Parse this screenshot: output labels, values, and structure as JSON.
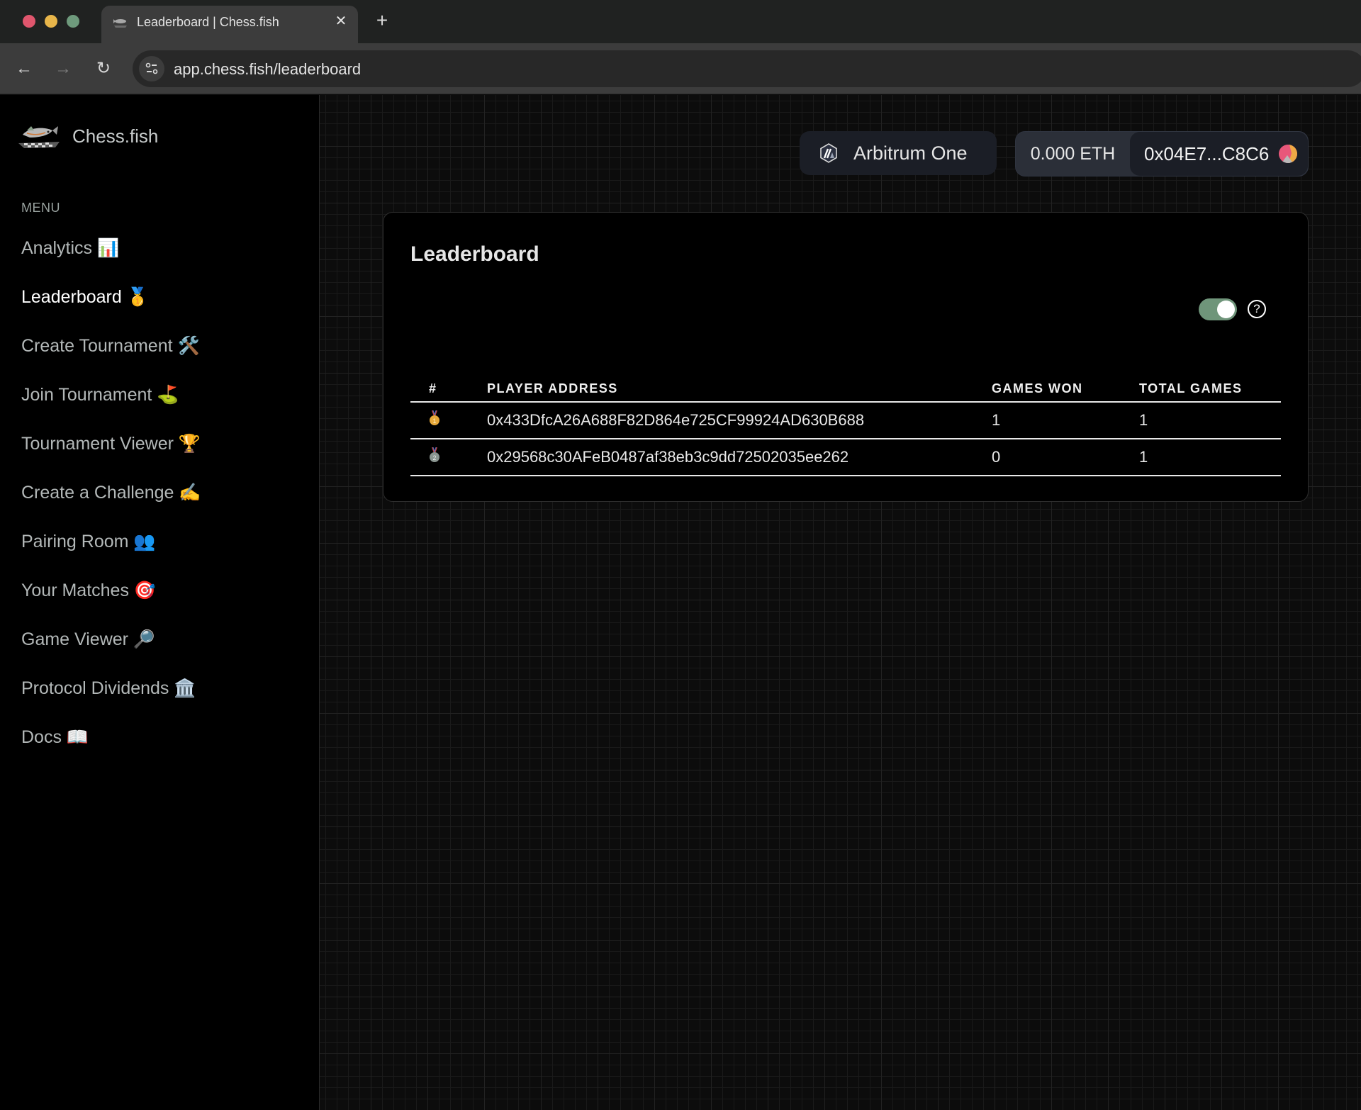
{
  "browser": {
    "tab_title": "Leaderboard | Chess.fish",
    "url": "app.chess.fish/leaderboard",
    "icons": {
      "back": "arrow-left-icon",
      "forward": "arrow-right-icon",
      "reload": "reload-icon",
      "site_info": "tune-icon",
      "close_tab": "close-icon",
      "new_tab": "plus-icon"
    }
  },
  "sidebar": {
    "brand": "Chess.fish",
    "menu_label": "MENU",
    "items": [
      {
        "label": "Analytics 📊",
        "active": false
      },
      {
        "label": "Leaderboard 🥇",
        "active": true
      },
      {
        "label": "Create Tournament 🛠️",
        "active": false
      },
      {
        "label": "Join Tournament ⛳",
        "active": false
      },
      {
        "label": "Tournament Viewer 🏆",
        "active": false
      },
      {
        "label": "Create a Challenge ✍️",
        "active": false
      },
      {
        "label": "Pairing Room 👥",
        "active": false
      },
      {
        "label": "Your Matches 🎯",
        "active": false
      },
      {
        "label": "Game Viewer 🔎",
        "active": false
      },
      {
        "label": "Protocol Dividends 🏛️",
        "active": false
      },
      {
        "label": "Docs 📖",
        "active": false
      }
    ]
  },
  "header": {
    "network": "Arbitrum One",
    "balance": "0.000 ETH",
    "account": "0x04E7...C8C6"
  },
  "leaderboard": {
    "title": "Leaderboard",
    "toggle_on": true,
    "help_symbol": "?",
    "columns": [
      "#",
      "PLAYER ADDRESS",
      "GAMES WON",
      "TOTAL GAMES"
    ],
    "rows": [
      {
        "rank": 1,
        "rank_icon": "gold-medal",
        "address": "0x433DfcA26A688F82D864e725CF99924AD630B688",
        "games_won": "1",
        "total_games": "1"
      },
      {
        "rank": 2,
        "rank_icon": "silver-medal",
        "address": "0x29568c30AFeB0487af38eb3c9dd72502035ee262",
        "games_won": "0",
        "total_games": "1"
      }
    ]
  },
  "colors": {
    "toggle_on": "#6f957a",
    "gold": "#e8a93a",
    "silver": "#8a9590",
    "sidebar_bg": "#000000",
    "main_bg": "#0c0c0c",
    "button_bg": "#1b1e26"
  }
}
